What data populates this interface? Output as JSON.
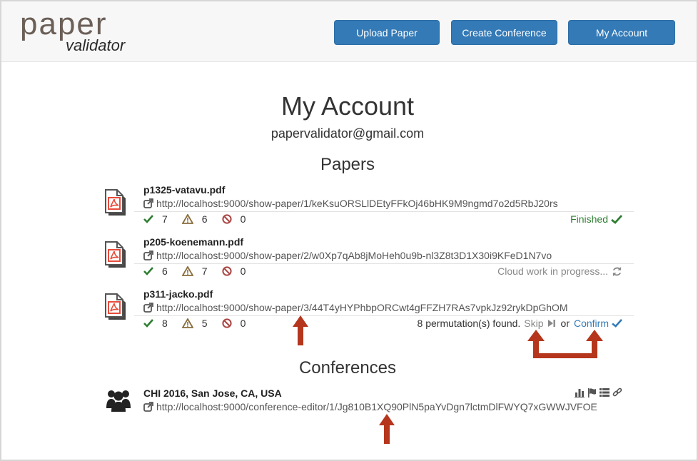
{
  "logo": {
    "line1": "paper",
    "line2": "validator"
  },
  "nav": {
    "upload": "Upload Paper",
    "create_conference": "Create Conference",
    "my_account": "My Account"
  },
  "title": "My Account",
  "email": "papervalidator@gmail.com",
  "papers_heading": "Papers",
  "papers": [
    {
      "name": "p1325-vatavu.pdf",
      "url": "http://localhost:9000/show-paper/1/keKsuORSLlDEtyFFkOj46bHK9M9ngmd7o2d5RbJ20rs",
      "passed": "7",
      "warnings": "6",
      "errors": "0",
      "status": "Finished"
    },
    {
      "name": "p205-koenemann.pdf",
      "url": "http://localhost:9000/show-paper/2/w0Xp7qAb8jMoHeh0u9b-nl3Z8t3D1X30i9KFeD1N7vo",
      "passed": "6",
      "warnings": "7",
      "errors": "0",
      "status": "Cloud work in progress..."
    },
    {
      "name": "p311-jacko.pdf",
      "url": "http://localhost:9000/show-paper/3/44T4yHYPhbpORCwt4gFFZH7RAs7vpkJz92rykDpGhOM",
      "passed": "8",
      "warnings": "5",
      "errors": "0",
      "status": "8 permutation(s) found.",
      "skip": "Skip",
      "or": "or",
      "confirm": "Confirm"
    }
  ],
  "conferences_heading": "Conferences",
  "conferences": [
    {
      "name": "CHI 2016, San Jose, CA, USA",
      "url": "http://localhost:9000/conference-editor/1/Jg810B1XQ90PlN5paYvDgn7lctmDlFWYQ7xGWWJVFOE"
    }
  ],
  "icons": {
    "pdf": "pdf-file-icon",
    "external": "external-link-icon",
    "check": "check-icon",
    "warning": "warning-icon",
    "ban": "ban-icon",
    "refresh": "refresh-icon",
    "skip": "step-forward-icon",
    "users": "users-icon",
    "chart": "bar-chart-icon",
    "flag": "flag-icon",
    "list": "list-icon",
    "link": "link-icon"
  },
  "colors": {
    "primary": "#337ab7",
    "success": "#2e7d32",
    "warning": "#8a6d3b",
    "danger": "#a94442",
    "annotation": "#b5361c",
    "pdf_red": "#e74c3c"
  }
}
